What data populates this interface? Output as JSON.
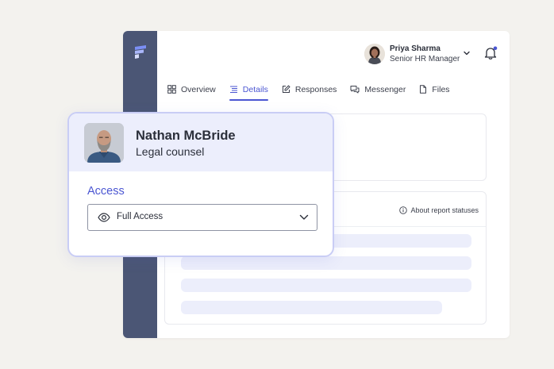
{
  "user": {
    "name": "Priya Sharma",
    "role": "Senior HR Manager"
  },
  "tabs": [
    {
      "label": "Overview",
      "icon": "grid-icon",
      "active": false
    },
    {
      "label": "Details",
      "icon": "list-icon",
      "active": true
    },
    {
      "label": "Responses",
      "icon": "edit-icon",
      "active": false
    },
    {
      "label": "Messenger",
      "icon": "chat-icon",
      "active": false
    },
    {
      "label": "Files",
      "icon": "file-icon",
      "active": false
    }
  ],
  "report": {
    "about_label": "About report statuses"
  },
  "popup": {
    "name": "Nathan McBride",
    "role": "Legal counsel",
    "access_label": "Access",
    "access_value": "Full Access"
  },
  "colors": {
    "accent": "#4b56d2",
    "sidebar": "#4b5675",
    "background": "#f3f2ee",
    "popup_header": "#eceefc",
    "notification_dot": "#4b56d2"
  }
}
